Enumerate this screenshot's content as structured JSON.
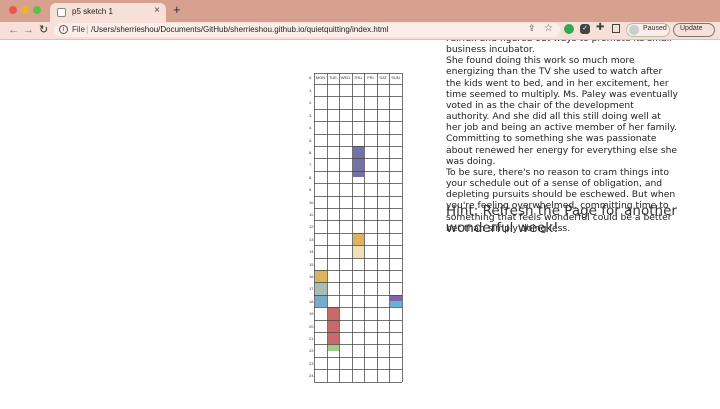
{
  "browser": {
    "tab_title": "p5 sketch 1",
    "tab_close": "×",
    "new_tab": "+",
    "back": "←",
    "forward": "→",
    "reload": "↻",
    "scheme": "File",
    "separator": "|",
    "url": "/Users/sherrieshou/Documents/GitHub/sherrieshou.github.io/quietquitting/index.html",
    "profile_label": "Paused",
    "update_label": "Update",
    "colors": {
      "tabbar": "#d8a08f",
      "toolbar": "#f6e0d7"
    }
  },
  "calendar": {
    "days": [
      "MON.",
      "TUE.",
      "WED.",
      "THU.",
      "FRI.",
      "SAT.",
      "SUN."
    ],
    "hours": [
      "0.",
      "1.",
      "2.",
      "3.",
      "4.",
      "5.",
      "6.",
      "7.",
      "8.",
      "9.",
      "10.",
      "11.",
      "12.",
      "13.",
      "14.",
      "15.",
      "16.",
      "17.",
      "18.",
      "19.",
      "20.",
      "21.",
      "22.",
      "23.",
      "24."
    ],
    "blocks": [
      {
        "day": 3,
        "start": 6,
        "end": 8.5,
        "color": "#5a5a9a"
      },
      {
        "day": 3,
        "start": 13,
        "end": 14,
        "color": "#d9a640"
      },
      {
        "day": 3,
        "start": 14,
        "end": 15,
        "color": "#ecd9a6"
      },
      {
        "day": 0,
        "start": 16,
        "end": 17,
        "color": "#d9a640"
      },
      {
        "day": 0,
        "start": 17,
        "end": 18,
        "color": "#9ab0a8"
      },
      {
        "day": 0,
        "start": 18,
        "end": 19,
        "color": "#5a9fbf"
      },
      {
        "day": 1,
        "start": 19,
        "end": 22,
        "color": "#c05050"
      },
      {
        "day": 1,
        "start": 22,
        "end": 22.5,
        "color": "#8fbf7a"
      },
      {
        "day": 6,
        "start": 18,
        "end": 18.5,
        "color": "#6a4aa0"
      },
      {
        "day": 6,
        "start": 18.5,
        "end": 19,
        "color": "#4aa8c8"
      }
    ]
  },
  "article": {
    "lines": [
      "Fairfax and figured out ways to promote its small business incubator.",
      "She found doing this work so much more energizing than the TV she used to watch after the kids went to bed, and in her excitement, her time seemed to multiply. Ms. Paley was eventually voted in as the chair of the development authority. And she did all this still doing well at her job and being an active member of her family. Committing to something she was passionate about renewed her energy for everything else she was doing.",
      "To be sure, there's no reason to cram things into your schedule out of a sense of obligation, and depleting pursuits should be eschewed. But when you're feeling overwhelmed, committing time to something that feels wonderful could be a better bet than simply doing less."
    ],
    "hint": "Hint: Refresh the Page for another wonderful week!"
  }
}
